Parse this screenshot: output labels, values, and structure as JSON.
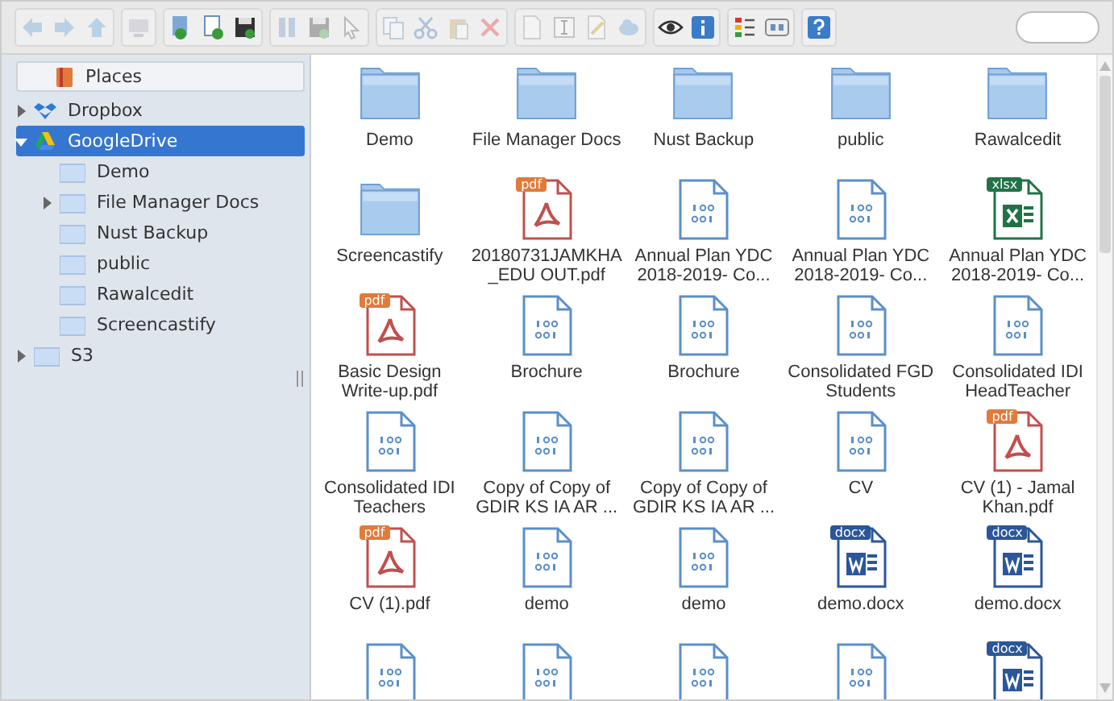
{
  "toolbar": {
    "groups": [
      [
        {
          "kind": "back",
          "disabled": true
        },
        {
          "kind": "forward",
          "disabled": true
        },
        {
          "kind": "up",
          "disabled": true
        }
      ],
      [
        {
          "kind": "computer",
          "disabled": true
        }
      ],
      [
        {
          "kind": "download",
          "disabled": false
        },
        {
          "kind": "upload",
          "disabled": false
        },
        {
          "kind": "save",
          "disabled": false
        }
      ],
      [
        {
          "kind": "columns",
          "disabled": true
        },
        {
          "kind": "save",
          "disabled": true
        },
        {
          "kind": "cursor",
          "disabled": true
        }
      ],
      [
        {
          "kind": "copy",
          "disabled": true
        },
        {
          "kind": "cut",
          "disabled": true
        },
        {
          "kind": "paste",
          "disabled": true
        },
        {
          "kind": "delete",
          "disabled": true
        }
      ],
      [
        {
          "kind": "document",
          "disabled": true
        },
        {
          "kind": "rename",
          "disabled": true
        },
        {
          "kind": "edit",
          "disabled": true
        },
        {
          "kind": "cloud",
          "disabled": true
        }
      ],
      [
        {
          "kind": "eye",
          "disabled": false
        },
        {
          "kind": "info",
          "disabled": false
        }
      ],
      [
        {
          "kind": "list",
          "disabled": false
        },
        {
          "kind": "icons",
          "disabled": false
        }
      ],
      [
        {
          "kind": "help",
          "disabled": false
        }
      ]
    ]
  },
  "sidebar": {
    "header": "Places",
    "tree": [
      {
        "label": "Dropbox",
        "kind": "dropbox",
        "expanded": false,
        "selected": false
      },
      {
        "label": "GoogleDrive",
        "kind": "drive",
        "expanded": true,
        "selected": true,
        "children": [
          {
            "label": "Demo",
            "kind": "folder",
            "selected": false
          },
          {
            "label": "File Manager Docs",
            "kind": "folder",
            "expanded": false,
            "selected": false
          },
          {
            "label": "Nust Backup",
            "kind": "folder",
            "selected": false
          },
          {
            "label": "public",
            "kind": "folder",
            "selected": false
          },
          {
            "label": "Rawalcedit",
            "kind": "folder",
            "selected": false
          },
          {
            "label": "Screencastify",
            "kind": "folder",
            "selected": false
          }
        ]
      },
      {
        "label": "S3",
        "kind": "folder",
        "expanded": false,
        "selected": false
      }
    ]
  },
  "files": [
    {
      "name": "Demo",
      "kind": "folder"
    },
    {
      "name": "File Manager Docs",
      "kind": "folder"
    },
    {
      "name": "Nust Backup",
      "kind": "folder"
    },
    {
      "name": "public",
      "kind": "folder"
    },
    {
      "name": "Rawalcedit",
      "kind": "folder"
    },
    {
      "name": "Screencastify",
      "kind": "folder"
    },
    {
      "name": "20180731JAMKHA _EDU OUT.pdf",
      "kind": "pdf",
      "badge": "pdf"
    },
    {
      "name": "Annual Plan YDC 2018-2019- Co...",
      "kind": "binary"
    },
    {
      "name": "Annual Plan YDC 2018-2019- Co...",
      "kind": "binary"
    },
    {
      "name": "Annual Plan YDC 2018-2019- Co...",
      "kind": "xlsx",
      "badge": "xlsx"
    },
    {
      "name": "Basic Design Write-up.pdf",
      "kind": "pdf",
      "badge": "pdf"
    },
    {
      "name": "Brochure",
      "kind": "binary"
    },
    {
      "name": "Brochure",
      "kind": "binary"
    },
    {
      "name": "Consolidated FGD Students",
      "kind": "binary"
    },
    {
      "name": "Consolidated IDI HeadTeacher",
      "kind": "binary"
    },
    {
      "name": "Consolidated IDI Teachers",
      "kind": "binary"
    },
    {
      "name": "Copy of Copy of GDIR KS IA AR ...",
      "kind": "binary"
    },
    {
      "name": "Copy of Copy of GDIR KS IA AR ...",
      "kind": "binary"
    },
    {
      "name": "CV",
      "kind": "binary"
    },
    {
      "name": "CV (1) - Jamal Khan.pdf",
      "kind": "pdf",
      "badge": "pdf"
    },
    {
      "name": "CV (1).pdf",
      "kind": "pdf",
      "badge": "pdf"
    },
    {
      "name": "demo",
      "kind": "binary"
    },
    {
      "name": "demo",
      "kind": "binary"
    },
    {
      "name": "demo.docx",
      "kind": "docx",
      "badge": "docx"
    },
    {
      "name": "demo.docx",
      "kind": "docx",
      "badge": "docx"
    },
    {
      "kind": "binary"
    },
    {
      "kind": "binary"
    },
    {
      "kind": "binary"
    },
    {
      "kind": "binary"
    },
    {
      "kind": "docx",
      "badge": "docx"
    }
  ]
}
